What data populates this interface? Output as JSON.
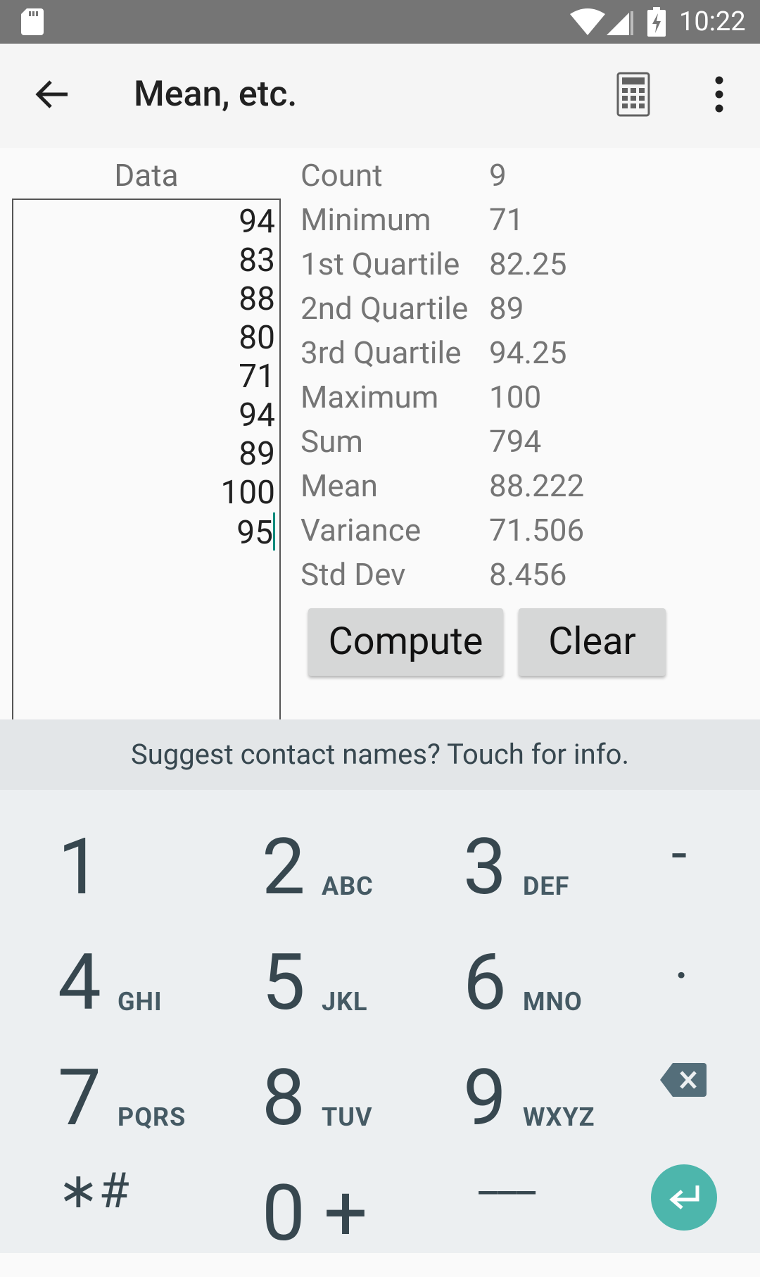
{
  "status_bar": {
    "time": "10:22"
  },
  "toolbar": {
    "title": "Mean, etc."
  },
  "data_panel": {
    "header": "Data",
    "values": [
      "94",
      "83",
      "88",
      "80",
      "71",
      "94",
      "89",
      "100",
      "95"
    ]
  },
  "stats": [
    {
      "label": "Count",
      "value": "9"
    },
    {
      "label": "Minimum",
      "value": "71"
    },
    {
      "label": "1st Quartile",
      "value": "82.25"
    },
    {
      "label": "2nd Quartile",
      "value": "89"
    },
    {
      "label": "3rd Quartile",
      "value": "94.25"
    },
    {
      "label": "Maximum",
      "value": "100"
    },
    {
      "label": "Sum",
      "value": "794"
    },
    {
      "label": "Mean",
      "value": "88.222"
    },
    {
      "label": "Variance",
      "value": "71.506"
    },
    {
      "label": "Std Dev",
      "value": "8.456"
    }
  ],
  "buttons": {
    "compute": "Compute",
    "clear": "Clear"
  },
  "keyboard": {
    "suggestion": "Suggest contact names? Touch for info.",
    "keys": [
      {
        "num": "1",
        "letters": ""
      },
      {
        "num": "2",
        "letters": "ABC"
      },
      {
        "num": "3",
        "letters": "DEF"
      },
      {
        "num": "4",
        "letters": "GHI"
      },
      {
        "num": "5",
        "letters": "JKL"
      },
      {
        "num": "6",
        "letters": "MNO"
      },
      {
        "num": "7",
        "letters": "PQRS"
      },
      {
        "num": "8",
        "letters": "TUV"
      },
      {
        "num": "9",
        "letters": "WXYZ"
      },
      {
        "num": "0",
        "letters": "+"
      }
    ],
    "minus": "-",
    "dot": ".",
    "star_hash": "∗#",
    "space": "___"
  },
  "colors": {
    "accent": "#4db6ac",
    "cursor": "#00897b"
  }
}
